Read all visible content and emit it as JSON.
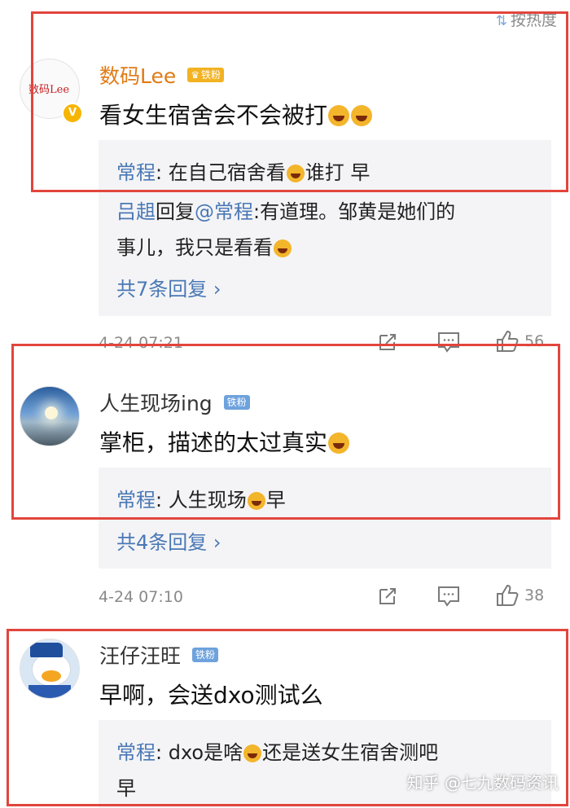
{
  "sort_label": "按热度",
  "comments": [
    {
      "user": "数码Lee",
      "badge": "铁粉",
      "avatar_text": "数码Lee",
      "text": "看女生宿舍会不会被打",
      "replies": [
        {
          "user": "常程",
          "sep": ": ",
          "text_before": "在自己宿舍看",
          "text_after": "谁打 早"
        },
        {
          "user": "吕趄",
          "mid": "回复",
          "mention": "@常程",
          "text_line1": ":有道理。邹黄是她们的",
          "text_line2": "事儿，我只是看看"
        }
      ],
      "more": "共7条回复 ›",
      "time": "4-24 07:21",
      "likes": "56"
    },
    {
      "user": "人生现场ing",
      "badge": "铁粉",
      "text": "掌柜，描述的太过真实",
      "replies": [
        {
          "user": "常程",
          "sep": ": ",
          "text_before": "人生现场",
          "text_after": "早"
        }
      ],
      "more": "共4条回复 ›",
      "time": "4-24 07:10",
      "likes": "38"
    },
    {
      "user": "汪仔汪旺",
      "badge": "铁粉",
      "text": "早啊，会送dxo测试么",
      "replies": [
        {
          "user": "常程",
          "sep": ": ",
          "text_before": "dxo是啥",
          "text_after": "还是送女生宿舍测吧",
          "text_line2": "早"
        }
      ]
    }
  ],
  "watermark": "知乎 @七九数码资讯",
  "colors": {
    "accent": "#4a78b5",
    "username_gold": "#e07b16",
    "highlight_box": "#e2453d"
  }
}
